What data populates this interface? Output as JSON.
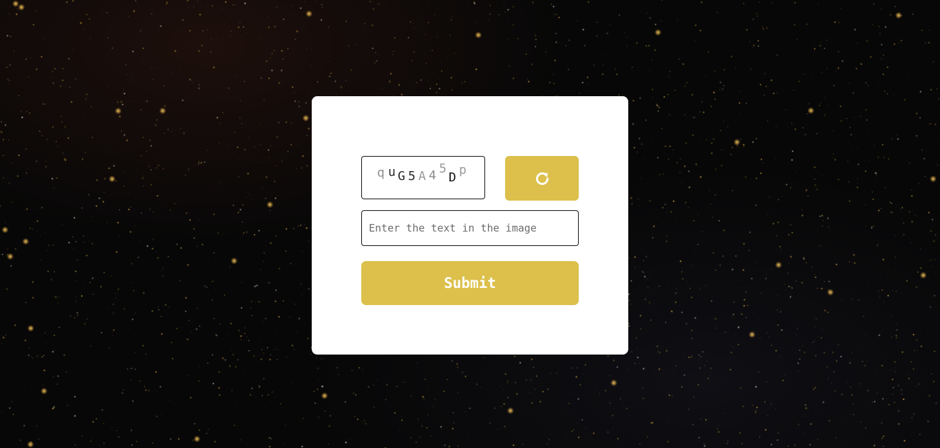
{
  "captcha": {
    "chars": [
      {
        "char": "q",
        "color": "#8f8f8f"
      },
      {
        "char": "u",
        "color": "#2a2a2a"
      },
      {
        "char": "G",
        "color": "#2a2a2a"
      },
      {
        "char": "5",
        "color": "#2a2a2a"
      },
      {
        "char": "A",
        "color": "#9a9a9a"
      },
      {
        "char": "4",
        "color": "#8a8a8a"
      },
      {
        "char": "5",
        "color": "#9a9a9a"
      },
      {
        "char": "D",
        "color": "#111111"
      },
      {
        "char": "p",
        "color": "#9a9a9a"
      }
    ]
  },
  "refresh": {
    "icon": "refresh-icon"
  },
  "input": {
    "placeholder": "Enter the text in the image",
    "value": ""
  },
  "submit": {
    "label": "Submit"
  },
  "colors": {
    "accent": "#dcc04b",
    "card": "#ffffff",
    "background": "#070707",
    "star": "#f2c24a"
  }
}
